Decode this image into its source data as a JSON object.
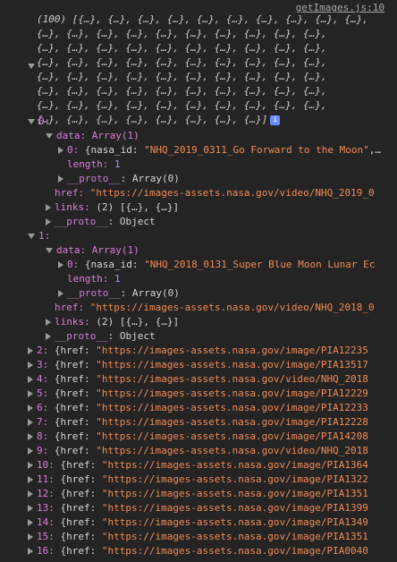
{
  "source_link": "getImages.js:10",
  "summary": {
    "count": "(100)",
    "line1": "[{…}, {…}, {…}, {…}, {…}, {…}, {…}, {…}, {…}, {…},",
    "repeat_line": "{…}, {…}, {…}, {…}, {…}, {…}, {…}, {…}, {…}, {…},",
    "last_line": "{…}, {…}, {…}, {…}, {…}, {…}, {…}, {…}]",
    "info_glyph": "i"
  },
  "tree": {
    "item0": {
      "index": "0:",
      "data_label": "data: Array(1)",
      "data_item": {
        "idx": "0:",
        "key": "{nasa_id:",
        "value": "\"NHQ_2019_0311_Go Forward to the Moon\""
      },
      "length_label": "length:",
      "length_value": "1",
      "proto_label": "__proto__",
      "proto_value": ": Array(0)",
      "href_key": "href:",
      "href_value": "\"https://images-assets.nasa.gov/video/NHQ_2019_0",
      "links_label": "links:",
      "links_value": "(2) [{…}, {…}]",
      "obj_proto_label": "__proto__",
      "obj_proto_value": ": Object"
    },
    "item1": {
      "index": "1:",
      "data_label": "data: Array(1)",
      "data_item": {
        "idx": "0:",
        "key": "{nasa_id:",
        "value": "\"NHQ_2018_0131_Super Blue Moon Lunar Ec"
      },
      "length_label": "length:",
      "length_value": "1",
      "proto_label": "__proto__",
      "proto_value": ": Array(0)",
      "href_key": "href:",
      "href_value": "\"https://images-assets.nasa.gov/video/NHQ_2018_0",
      "links_label": "links:",
      "links_value": "(2) [{…}, {…}]",
      "obj_proto_label": "__proto__",
      "obj_proto_value": ": Object"
    },
    "collapsed": [
      {
        "idx": "2:",
        "value": "\"https://images-assets.nasa.gov/image/PIA12235"
      },
      {
        "idx": "3:",
        "value": "\"https://images-assets.nasa.gov/image/PIA13517"
      },
      {
        "idx": "4:",
        "value": "\"https://images-assets.nasa.gov/video/NHQ_2018"
      },
      {
        "idx": "5:",
        "value": "\"https://images-assets.nasa.gov/image/PIA12229"
      },
      {
        "idx": "6:",
        "value": "\"https://images-assets.nasa.gov/image/PIA12233"
      },
      {
        "idx": "7:",
        "value": "\"https://images-assets.nasa.gov/image/PIA12228"
      },
      {
        "idx": "8:",
        "value": "\"https://images-assets.nasa.gov/image/PIA14208"
      },
      {
        "idx": "9:",
        "value": "\"https://images-assets.nasa.gov/video/NHQ_2018"
      },
      {
        "idx": "10:",
        "value": "\"https://images-assets.nasa.gov/image/PIA1364"
      },
      {
        "idx": "11:",
        "value": "\"https://images-assets.nasa.gov/image/PIA1322"
      },
      {
        "idx": "12:",
        "value": "\"https://images-assets.nasa.gov/image/PIA1351"
      },
      {
        "idx": "13:",
        "value": "\"https://images-assets.nasa.gov/image/PIA1399"
      },
      {
        "idx": "14:",
        "value": "\"https://images-assets.nasa.gov/image/PIA1349"
      },
      {
        "idx": "15:",
        "value": "\"https://images-assets.nasa.gov/image/PIA1351"
      },
      {
        "idx": "16:",
        "value": "\"https://images-assets.nasa.gov/image/PIA0040"
      }
    ],
    "href_key": "{href:"
  },
  "colors": {
    "background": "#242424",
    "key": "#de7ed9",
    "string": "#f28b54",
    "number": "#9e9ef8"
  }
}
